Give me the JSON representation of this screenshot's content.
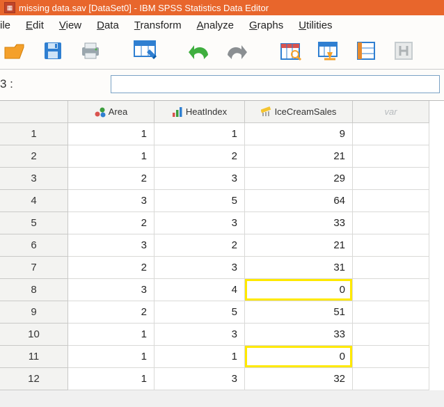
{
  "window": {
    "title": "missing data.sav [DataSet0] - IBM SPSS Statistics Data Editor"
  },
  "menu": {
    "file": "ile",
    "edit": "Edit",
    "view": "View",
    "data": "Data",
    "transform": "Transform",
    "analyze": "Analyze",
    "graphs": "Graphs",
    "utilities": "Utilities"
  },
  "statusbar": {
    "label": "3 :",
    "value": ""
  },
  "columns": {
    "area": "Area",
    "heatindex": "HeatIndex",
    "icecream": "IceCreamSales",
    "var": "var"
  },
  "rows": [
    {
      "n": "1",
      "area": "1",
      "heat": "1",
      "ice": "9",
      "hl": false
    },
    {
      "n": "2",
      "area": "1",
      "heat": "2",
      "ice": "21",
      "hl": false
    },
    {
      "n": "3",
      "area": "2",
      "heat": "3",
      "ice": "29",
      "hl": false
    },
    {
      "n": "4",
      "area": "3",
      "heat": "5",
      "ice": "64",
      "hl": false
    },
    {
      "n": "5",
      "area": "2",
      "heat": "3",
      "ice": "33",
      "hl": false
    },
    {
      "n": "6",
      "area": "3",
      "heat": "2",
      "ice": "21",
      "hl": false
    },
    {
      "n": "7",
      "area": "2",
      "heat": "3",
      "ice": "31",
      "hl": false
    },
    {
      "n": "8",
      "area": "3",
      "heat": "4",
      "ice": "0",
      "hl": true
    },
    {
      "n": "9",
      "area": "2",
      "heat": "5",
      "ice": "51",
      "hl": false
    },
    {
      "n": "10",
      "area": "1",
      "heat": "3",
      "ice": "33",
      "hl": false
    },
    {
      "n": "11",
      "area": "1",
      "heat": "1",
      "ice": "0",
      "hl": true
    },
    {
      "n": "12",
      "area": "1",
      "heat": "3",
      "ice": "32",
      "hl": false
    }
  ],
  "chart_data": {
    "type": "table",
    "title": "missing data.sav",
    "columns": [
      "Area",
      "HeatIndex",
      "IceCreamSales"
    ],
    "rows": [
      [
        1,
        1,
        9
      ],
      [
        1,
        2,
        21
      ],
      [
        2,
        3,
        29
      ],
      [
        3,
        5,
        64
      ],
      [
        2,
        3,
        33
      ],
      [
        3,
        2,
        21
      ],
      [
        2,
        3,
        31
      ],
      [
        3,
        4,
        0
      ],
      [
        2,
        5,
        51
      ],
      [
        1,
        3,
        33
      ],
      [
        1,
        1,
        0
      ],
      [
        1,
        3,
        32
      ]
    ],
    "highlighted_rows_index": [
      7,
      10
    ]
  }
}
